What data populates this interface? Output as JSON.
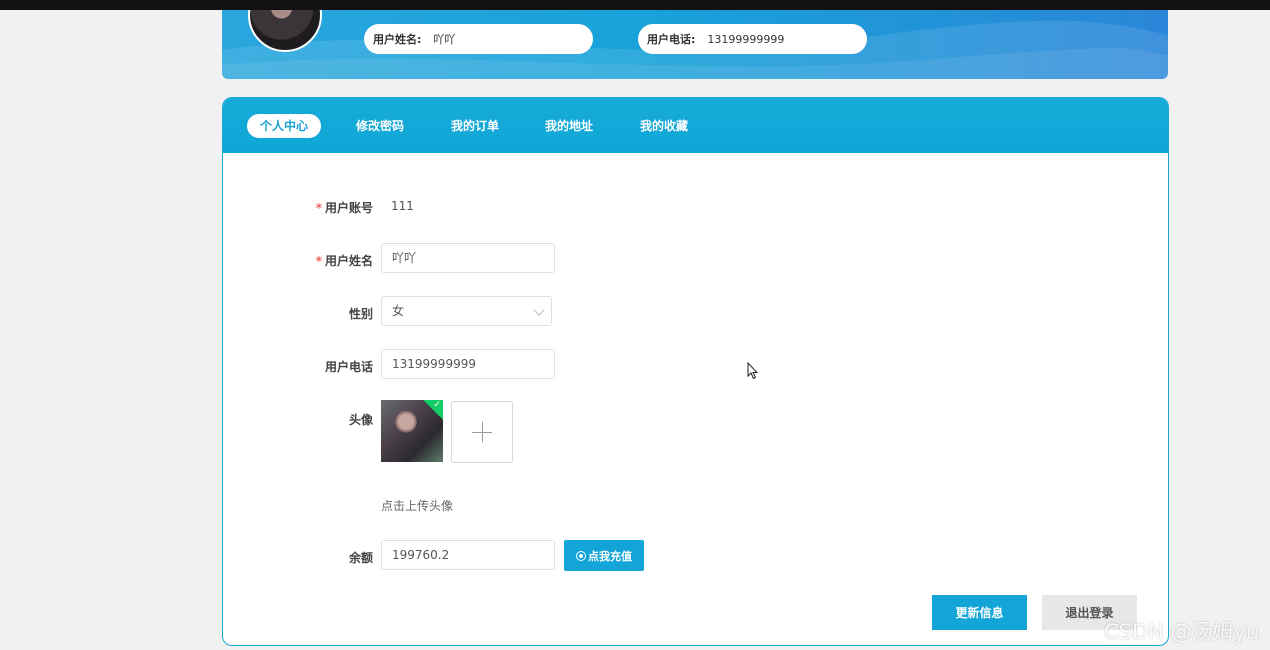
{
  "header": {
    "name_label": "用户姓名:",
    "name_value": "吖吖",
    "phone_label": "用户电话:",
    "phone_value": "13199999999"
  },
  "tabs": [
    {
      "label": "个人中心",
      "active": true
    },
    {
      "label": "修改密码",
      "active": false
    },
    {
      "label": "我的订单",
      "active": false
    },
    {
      "label": "我的地址",
      "active": false
    },
    {
      "label": "我的收藏",
      "active": false
    }
  ],
  "form": {
    "account": {
      "label": "用户账号",
      "value": "111",
      "required": true
    },
    "name": {
      "label": "用户姓名",
      "value": "吖吖",
      "required": true
    },
    "gender": {
      "label": "性别",
      "value": "女"
    },
    "phone": {
      "label": "用户电话",
      "value": "13199999999"
    },
    "avatar": {
      "label": "头像",
      "hint": "点击上传头像"
    },
    "balance": {
      "label": "余额",
      "value": "199760.2",
      "recharge_label": "点我充值"
    }
  },
  "actions": {
    "update_label": "更新信息",
    "logout_label": "退出登录"
  },
  "watermark": "CSDN @汤姆yu",
  "colors": {
    "primary": "#13a5d7",
    "required": "#f06060",
    "success": "#13ce66"
  }
}
